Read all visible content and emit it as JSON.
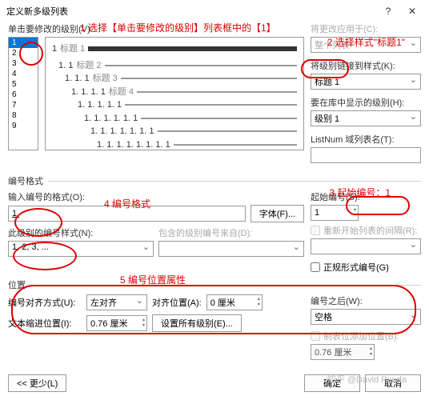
{
  "title": "定义新多级列表",
  "help_icon": "?",
  "close_icon": "✕",
  "ann1": "1 选择【单击要修改的级别】列表框中的【1】",
  "ann2": "2 选择样式\"标题1\"",
  "ann3": "3 起始编号：1",
  "ann4": "4 编号格式",
  "ann5": "5 编号位置属性",
  "lbl_click_level": "单击要修改的级别(V):",
  "lbl_apply_to": "将更改应用于(C):",
  "apply_to": "整个列表",
  "lbl_link_style": "将级别链接到样式(K):",
  "link_style": "标题 1",
  "lbl_show_in": "要在库中显示的级别(H):",
  "show_in": "级别 1",
  "lbl_listnum": "ListNum 域列表名(T):",
  "listnum": "",
  "levels": [
    "1",
    "2",
    "3",
    "4",
    "5",
    "6",
    "7",
    "8",
    "9"
  ],
  "hdr_main": "标题 1",
  "hdr2": "标题 2",
  "hdr3": "标题 3",
  "hdr4": "标题 4",
  "leg_numfmt": "编号格式",
  "lbl_enter_fmt": "输入编号的格式(O):",
  "num_fmt": "1.",
  "btn_font": "字体(F)...",
  "lbl_start": "起始编号(S):",
  "start": "1",
  "lbl_restart": "重新开始列表的间隔(R):",
  "lbl_num_style": "此级别的编号样式(N):",
  "num_style": "1, 2, 3, ...",
  "lbl_incl": "包含的级别编号来自(D):",
  "lbl_legal": "正规形式编号(G)",
  "leg_pos": "位置",
  "lbl_align": "编号对齐方式(U):",
  "align": "左对齐",
  "lbl_align_at": "对齐位置(A):",
  "align_at": "0 厘米",
  "lbl_follow": "编号之后(W):",
  "follow": "空格",
  "lbl_indent": "文本缩进位置(I):",
  "indent": "0.76 厘米",
  "btn_set_all": "设置所有级别(E)...",
  "lbl_tab": "制表位添加位置(B):",
  "tab": "0.76 厘米",
  "btn_less": "<< 更少(L)",
  "btn_ok": "确定",
  "btn_cancel": "取消",
  "watermark": "知乎 @David Panda"
}
